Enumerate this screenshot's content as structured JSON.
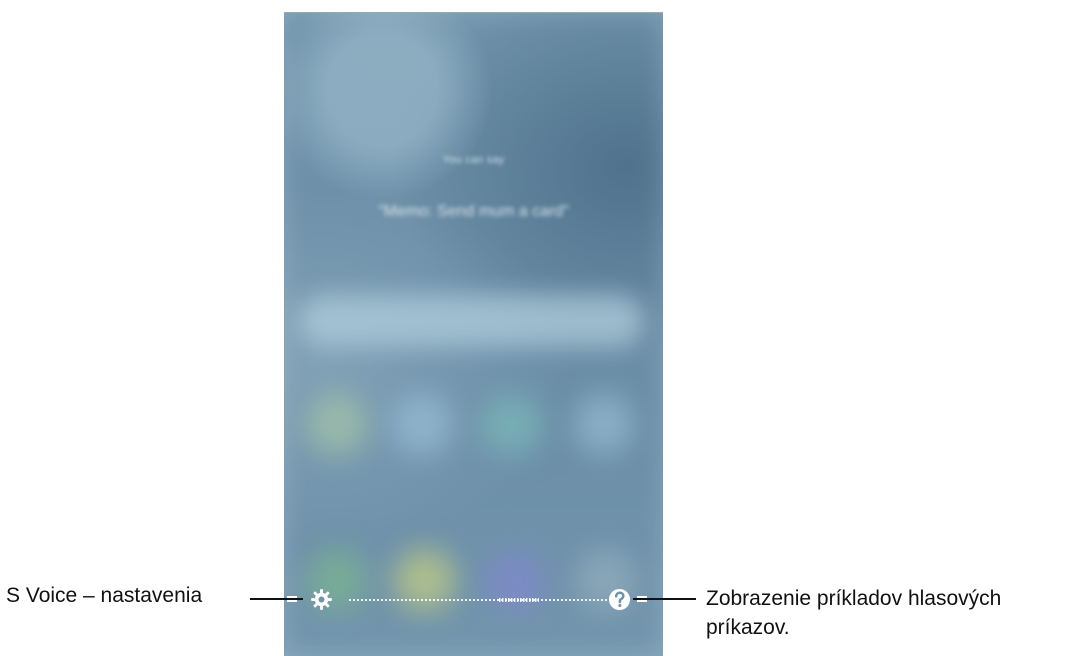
{
  "screen": {
    "hint_small": "You can say",
    "hint_quote": "\"Memo: Send mum a card\""
  },
  "bottom_bar": {
    "settings_icon": "gear-icon",
    "help_icon": "help-icon",
    "waveform": "voice-waveform"
  },
  "annotations": {
    "settings_label": "S Voice – nastavenia",
    "help_label": "Zobrazenie príkladov hlasových príkazov."
  },
  "colors": {
    "phone_base": "#6f93aa",
    "icon_white": "#ffffff",
    "annotation_text": "#111111"
  }
}
